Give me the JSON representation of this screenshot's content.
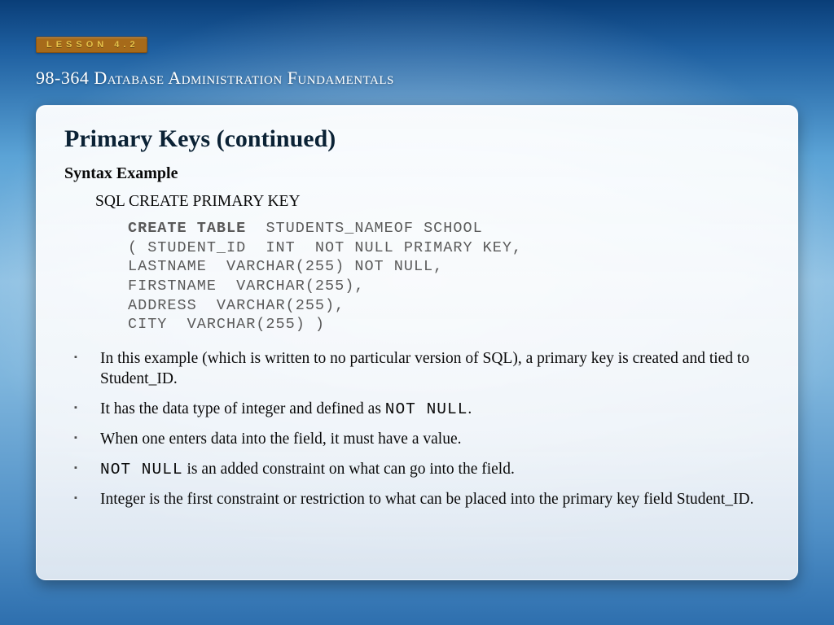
{
  "header": {
    "lesson_badge": "LESSON 4.2",
    "course_title": "98-364 Database Administration Fundamentals"
  },
  "content": {
    "title": "Primary Keys (continued)",
    "subtitle": "Syntax  Example",
    "sql_header": "SQL CREATE PRIMARY KEY",
    "code": {
      "kw": "CREATE TABLE",
      "l1_rest": "  STUDENTS_NAMEOF SCHOOL",
      "l2": "( STUDENT_ID  INT  NOT NULL PRIMARY KEY,",
      "l3": "LASTNAME  VARCHAR(255) NOT NULL,",
      "l4": "FIRSTNAME  VARCHAR(255),",
      "l5": "ADDRESS  VARCHAR(255),",
      "l6": "CITY  VARCHAR(255) )"
    },
    "bullets": {
      "b1": "In this example (which is written to no particular version of SQL), a primary key is created and tied to Student_ID.",
      "b2_a": "It has the data type of integer and defined as ",
      "b2_mono": "NOT NULL",
      "b2_b": ".",
      "b3": "When one enters data into the field, it must have a value.",
      "b4_mono": "NOT NULL",
      "b4_a": "  is an added constraint on what can go into the field.",
      "b5": "Integer is the first constraint or restriction to what can be placed into the primary key field Student_ID."
    }
  }
}
